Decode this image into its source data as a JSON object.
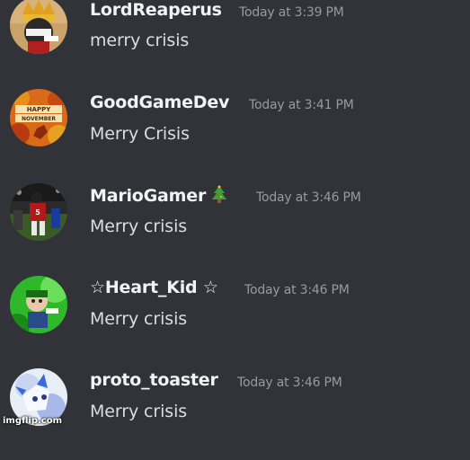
{
  "messages": [
    {
      "username": "LordReaperus",
      "timestamp": "Today at 3:39 PM",
      "content": "merry crisis",
      "avatar_icon": "crowned-character-avatar"
    },
    {
      "username": "GoodGameDev",
      "timestamp": "Today at 3:41 PM",
      "content": "Merry Crisis",
      "avatar_icon": "happy-november-avatar",
      "avatar_text_line1": "HAPPY",
      "avatar_text_line2": "NOVEMBER"
    },
    {
      "username": "MarioGamer",
      "timestamp": "Today at 3:46 PM",
      "content": "Merry crisis",
      "avatar_icon": "football-player-avatar",
      "username_decoration": "christmas-tree-icon"
    },
    {
      "username_prefix": "☆",
      "username": "Heart_Kid",
      "username_suffix": "☆",
      "timestamp": "Today at 3:46 PM",
      "content": "Merry crisis",
      "avatar_icon": "green-character-avatar"
    },
    {
      "username": "proto_toaster",
      "timestamp": "Today at 3:46 PM",
      "content": "Merry crisis",
      "avatar_icon": "blue-white-character-avatar"
    }
  ],
  "watermark": "imgflip.com",
  "colors": {
    "background": "#313338",
    "username": "#f2f3f5",
    "timestamp": "#949ba4",
    "content": "#dbdee1"
  }
}
